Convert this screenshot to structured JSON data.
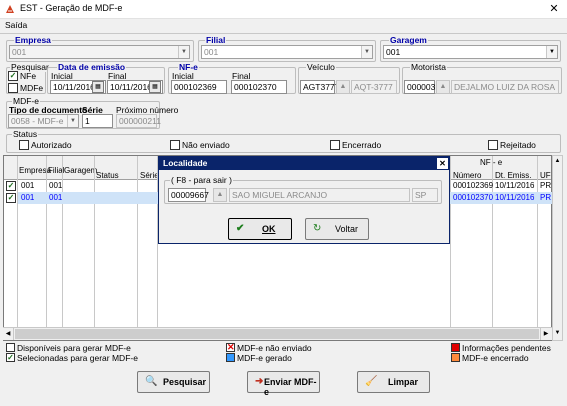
{
  "window": {
    "title": "EST - Geração de MDF-e",
    "close_glyph": "✕"
  },
  "menu": {
    "saida": "Saída"
  },
  "empresa": {
    "label": "Empresa",
    "value": "001"
  },
  "filial": {
    "label": "Filial",
    "value": "001"
  },
  "garagem": {
    "label": "Garagem",
    "value": "001"
  },
  "pesquisar": {
    "label": "Pesquisar",
    "nfe": "NFe",
    "mdfe": "MDFe"
  },
  "data_emissao": {
    "label": "Data de emissão",
    "inicial_label": "Inicial",
    "final_label": "Final",
    "inicial": "10/11/2016",
    "final": "10/11/2016"
  },
  "nfe_range": {
    "label": "NF-e",
    "inicial_label": "Inicial",
    "final_label": "Final",
    "inicial": "000102369",
    "final": "000102370"
  },
  "veiculo": {
    "label": "Veículo",
    "code": "AGT3777",
    "desc": "AQT-3777"
  },
  "motorista": {
    "label": "Motorista",
    "code": "000003",
    "name": "DEJALMO LUIZ DA ROSA"
  },
  "mdfe": {
    "label": "MDF-e",
    "tipo_label": "Tipo de documento",
    "tipo_value": "0058 - MDF-e",
    "serie_label": "Série",
    "serie_value": "1",
    "proximo_label": "Próximo número",
    "proximo_value": "000000211"
  },
  "status": {
    "label": "Status",
    "options": [
      "Autorizado",
      "Não enviado",
      "Encerrado",
      "Rejeitado"
    ]
  },
  "grid": {
    "headers": {
      "empresa": "Empresa",
      "filial": "Filial",
      "garagem": "Garagem",
      "status": "Status",
      "serie": "Série",
      "nfe_group": "NF - e",
      "numero": "Número",
      "dt_emis": "Dt. Emiss.",
      "uf": "UF"
    },
    "rows": [
      {
        "empresa": "001",
        "filial": "001",
        "numero": "000102369",
        "dt": "10/11/2016",
        "uf": "PR"
      },
      {
        "empresa": "001",
        "filial": "001",
        "numero": "000102370",
        "dt": "10/11/2016",
        "uf": "PR"
      }
    ]
  },
  "legend": {
    "disponiveis": "Disponíveis para gerar MDF-e",
    "selecionadas": "Selecionadas para gerar MDF-e",
    "nao_enviado": "MDF-e não enviado",
    "gerado": "MDF-e gerado",
    "pendentes": "Informações pendentes",
    "encerrado": "MDF-e encerrado",
    "colors": {
      "nao_enviado": "#ffffff",
      "gerado": "#3399ff",
      "pendentes": "#e00000",
      "encerrado": "#ff8a3c"
    }
  },
  "buttons": {
    "pesquisar": "Pesquisar",
    "enviar": "Enviar MDF-e",
    "limpar": "Limpar"
  },
  "dialog": {
    "title": "Localidade",
    "group_label": "( F8 - para sair )",
    "code": "00009667",
    "city": "SAO MIGUEL ARCANJO",
    "uf": "SP",
    "ok": "OK",
    "voltar": "Voltar"
  }
}
